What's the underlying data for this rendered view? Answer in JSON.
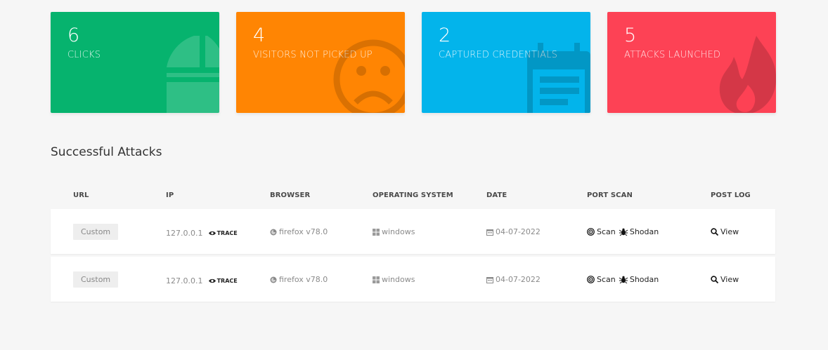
{
  "cards": [
    {
      "value": "6",
      "label": "CLICKS",
      "color": "#06b36e",
      "icon": "chart-icon"
    },
    {
      "value": "4",
      "label": "VISITORS NOT PICKED UP",
      "color": "#ff8503",
      "icon": "sad-face-icon"
    },
    {
      "value": "2",
      "label": "CAPTURED CREDENTIALS",
      "color": "#03b4eb",
      "icon": "calendar-form-icon"
    },
    {
      "value": "5",
      "label": "ATTACKS LAUNCHED",
      "color": "#fd4255",
      "icon": "fire-icon"
    }
  ],
  "section": {
    "title": "Successful Attacks"
  },
  "table": {
    "headers": [
      "URL",
      "IP",
      "BROWSER",
      "OPERATING SYSTEM",
      "DATE",
      "PORT SCAN",
      "POST LOG"
    ],
    "rows": [
      {
        "url": "Custom",
        "ip": "127.0.0.1",
        "trace": "TRACE",
        "browser": "firefox v78.0",
        "os": "windows",
        "date": "04-07-2022",
        "scan": "Scan",
        "shodan": "Shodan",
        "view": "View"
      },
      {
        "url": "Custom",
        "ip": "127.0.0.1",
        "trace": "TRACE",
        "browser": "firefox v78.0",
        "os": "windows",
        "date": "04-07-2022",
        "scan": "Scan",
        "shodan": "Shodan",
        "view": "View"
      }
    ]
  }
}
